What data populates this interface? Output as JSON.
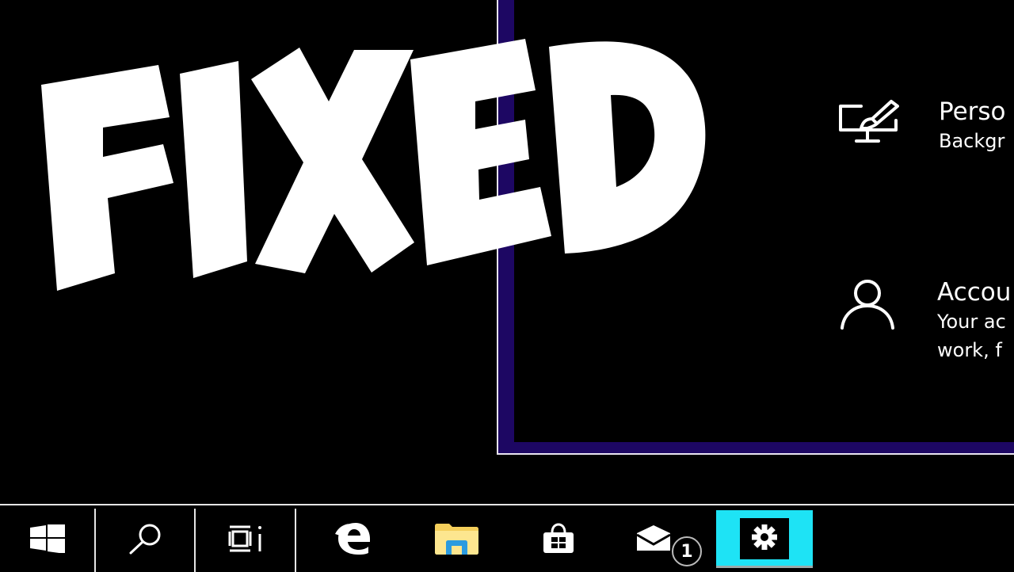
{
  "overlay": {
    "headline": "FIXED",
    "headline_color": "#ffffff"
  },
  "settings_window": {
    "accent_color": "#1d0763",
    "items": [
      {
        "icon": "personalization-icon",
        "title": "Perso",
        "description_lines": [
          "Backgr"
        ]
      },
      {
        "icon": "accounts-icon",
        "title": "Accou",
        "description_lines": [
          "Your ac",
          "work, f"
        ]
      }
    ]
  },
  "taskbar": {
    "items": [
      {
        "name": "start",
        "icon": "windows-logo-icon"
      },
      {
        "name": "search",
        "icon": "search-icon"
      },
      {
        "name": "task-view",
        "icon": "task-view-icon"
      },
      {
        "name": "edge",
        "icon": "edge-icon"
      },
      {
        "name": "file-explorer",
        "icon": "folder-icon"
      },
      {
        "name": "store",
        "icon": "store-bag-icon"
      },
      {
        "name": "mail",
        "icon": "mail-icon",
        "badge": "1"
      },
      {
        "name": "settings",
        "icon": "gear-icon",
        "active": true
      }
    ],
    "active_highlight_color": "#1ee3f5"
  }
}
